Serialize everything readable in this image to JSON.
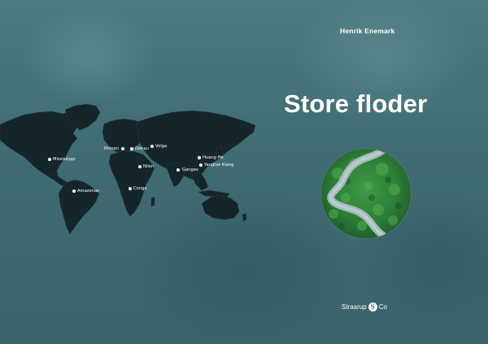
{
  "cover": {
    "author": "Henrik Enemark",
    "title": "Store floder",
    "publisher": {
      "name_part1": "Straarup",
      "logo_letter": "S",
      "name_part2": "Co"
    }
  },
  "map": {
    "rivers": [
      {
        "id": "mississippi",
        "label": "Mississippi"
      },
      {
        "id": "amazonas",
        "label": "Amazonas"
      },
      {
        "id": "rhinen",
        "label": "Rhinen"
      },
      {
        "id": "donau",
        "label": "Donau"
      },
      {
        "id": "volga",
        "label": "Volga"
      },
      {
        "id": "nilen",
        "label": "Nilen"
      },
      {
        "id": "congo",
        "label": "Congo"
      },
      {
        "id": "ganges",
        "label": "Ganges"
      },
      {
        "id": "huang-he",
        "label": "Huang He"
      },
      {
        "id": "yangtze-kiang",
        "label": "Yangtze Kiang"
      }
    ]
  },
  "colors": {
    "background": "#45727a",
    "map_land": "#15262b",
    "text": "#ffffff"
  }
}
